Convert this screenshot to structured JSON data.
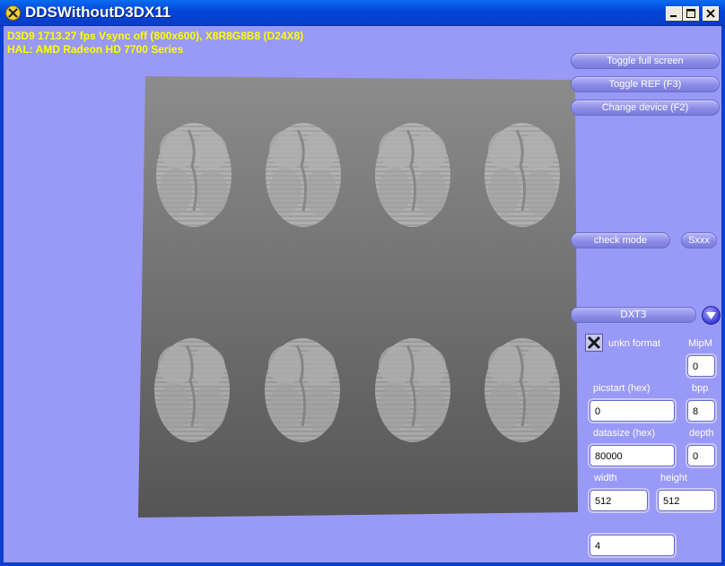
{
  "window": {
    "title": "DDSWithoutD3DX11"
  },
  "stats": {
    "line1": "D3D9 1713.27 fps Vsync off (800x600), X8R8G8B8 (D24X8)",
    "line2": "HAL: AMD Radeon HD 7700 Series"
  },
  "buttons": {
    "toggle_full_screen": "Toggle full screen",
    "toggle_ref": "Toggle REF (F3)",
    "change_device": "Change device (F2)",
    "check_mode": "check mode",
    "sxxx": "Sxxx"
  },
  "format": {
    "selected": "DXT3",
    "checkbox_label": "unkn format",
    "checked": true
  },
  "fields": {
    "mipm": {
      "label": "MipM",
      "value": "0"
    },
    "picstart": {
      "label": "picstart  (hex)",
      "value": "0"
    },
    "bpp": {
      "label": "bpp",
      "value": "8"
    },
    "datasize": {
      "label": "datasize  (hex)",
      "value": "80000"
    },
    "depth": {
      "label": "depth",
      "value": "0"
    },
    "width": {
      "label": "width",
      "value": "512"
    },
    "height": {
      "label": "height",
      "value": "512"
    },
    "extra": {
      "value": "4"
    }
  },
  "colors": {
    "client_background": "#9999f7",
    "stats_text": "#ffff00"
  }
}
